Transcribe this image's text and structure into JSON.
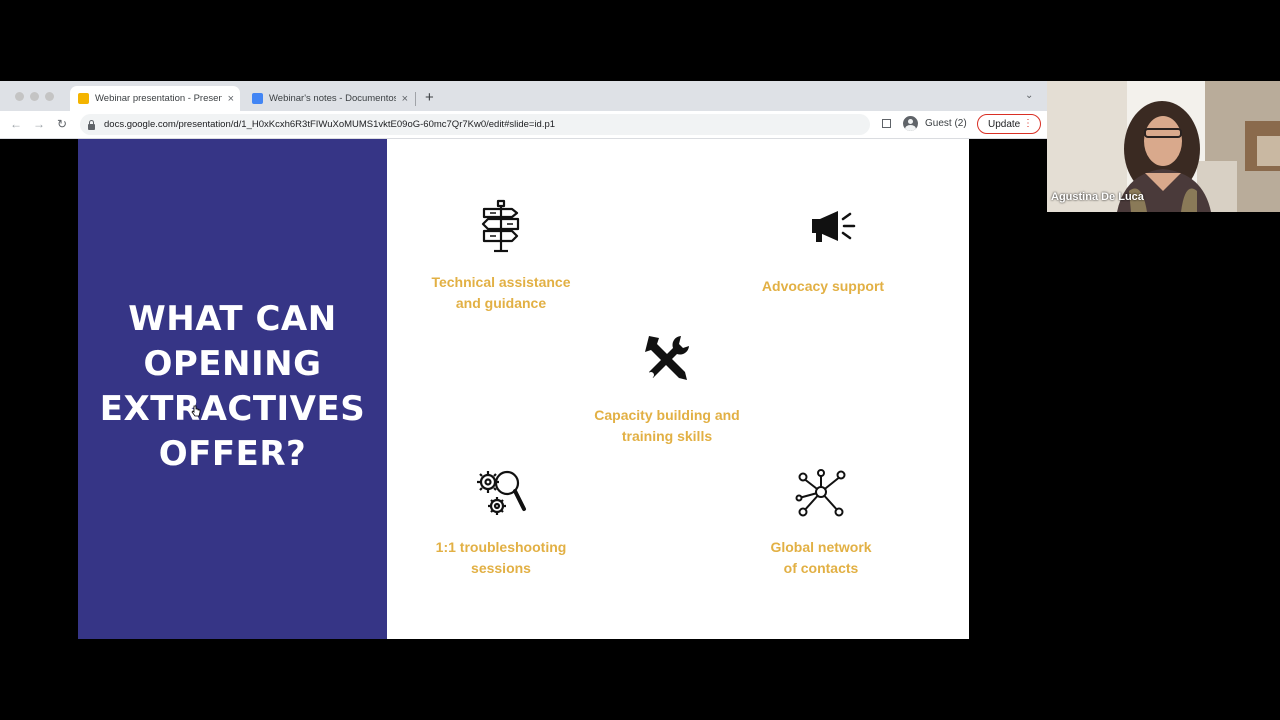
{
  "browser": {
    "tabs": [
      {
        "title": "Webinar presentation - Presentations",
        "favicon_color": "#f4b400",
        "active": true
      },
      {
        "title": "Webinar's notes - Documentos",
        "favicon_color": "#4285f4",
        "active": false
      }
    ],
    "new_tab_label": "+",
    "tab_menu_label": "⌄",
    "url": "docs.google.com/presentation/d/1_H0xKcxh6R3tFIWuXoMUMS1vktE09oG-60mc7Qr7Kw0/edit#slide=id.p1",
    "profile_label": "Guest (2)",
    "update_label": "Update",
    "nav_back": "←",
    "nav_forward": "→",
    "nav_reload": "↻",
    "menu_dots": "⋮",
    "close_glyph": "×"
  },
  "slide": {
    "title_lines": [
      "WHAT CAN",
      "OPENING",
      "EXTRACTIVES",
      "OFFER?"
    ],
    "panel_color": "#363586",
    "accent_color": "#e2b044",
    "features": [
      {
        "icon": "signpost-icon",
        "lines": [
          "Technical assistance",
          "and guidance"
        ]
      },
      {
        "icon": "megaphone-icon",
        "lines": [
          "Advocacy support"
        ]
      },
      {
        "icon": "tools-icon",
        "lines": [
          "Capacity building and",
          "training skills"
        ]
      },
      {
        "icon": "gears-magnifier-icon",
        "lines": [
          "1:1 troubleshooting",
          "sessions"
        ]
      },
      {
        "icon": "network-icon",
        "lines": [
          "Global network",
          "of contacts"
        ]
      }
    ]
  },
  "participant": {
    "name": "Agustina De Luca"
  }
}
